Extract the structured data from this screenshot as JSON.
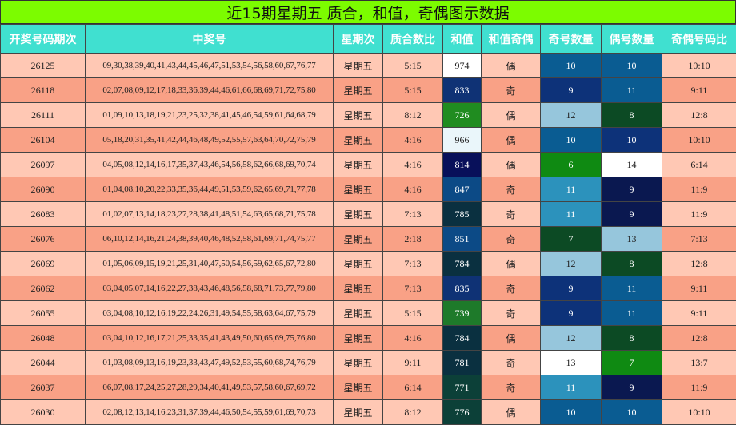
{
  "title": "近15期星期五 质合，和值，奇偶图示数据",
  "headers": [
    "开奖号码期次",
    "中奖号",
    "星期次",
    "质合数比",
    "和值",
    "和值奇偶",
    "奇号数量",
    "偶号数量",
    "奇偶号码比"
  ],
  "rows": [
    {
      "issue": "26125",
      "numbers": "09,30,38,39,40,41,43,44,45,46,47,51,53,54,56,58,60,67,76,77",
      "weekday": "星期五",
      "prime_ratio": "5:15",
      "sum": "974",
      "sum_parity": "偶",
      "odd_count": "10",
      "even_count": "10",
      "oe_ratio": "10:10",
      "sum_bg": "#ffffff",
      "sum_fg": "#222222",
      "odd_bg": "#0a5c92",
      "even_bg": "#0a5c92",
      "odd_fg": "#ffffff",
      "even_fg": "#ffffff"
    },
    {
      "issue": "26118",
      "numbers": "02,07,08,09,12,17,18,33,36,39,44,46,61,66,68,69,71,72,75,80",
      "weekday": "星期五",
      "prime_ratio": "5:15",
      "sum": "833",
      "sum_parity": "奇",
      "odd_count": "9",
      "even_count": "11",
      "oe_ratio": "9:11",
      "sum_bg": "#0f3275",
      "sum_fg": "#ffffff",
      "odd_bg": "#0d3279",
      "even_bg": "#0a5c92",
      "odd_fg": "#ffffff",
      "even_fg": "#ffffff"
    },
    {
      "issue": "26111",
      "numbers": "01,09,10,13,18,19,21,23,25,32,38,41,45,46,54,59,61,64,68,79",
      "weekday": "星期五",
      "prime_ratio": "8:12",
      "sum": "726",
      "sum_parity": "偶",
      "odd_count": "12",
      "even_count": "8",
      "oe_ratio": "12:8",
      "sum_bg": "#208c20",
      "sum_fg": "#ffffff",
      "odd_bg": "#96c6dc",
      "even_bg": "#0c4a24",
      "odd_fg": "#222222",
      "even_fg": "#ffffff"
    },
    {
      "issue": "26104",
      "numbers": "05,18,20,31,35,41,42,44,46,48,49,52,55,57,63,64,70,72,75,79",
      "weekday": "星期五",
      "prime_ratio": "4:16",
      "sum": "966",
      "sum_parity": "偶",
      "odd_count": "10",
      "even_count": "10",
      "oe_ratio": "10:10",
      "sum_bg": "#eaf6fa",
      "sum_fg": "#222222",
      "odd_bg": "#0a5c92",
      "even_bg": "#0d3279",
      "odd_fg": "#ffffff",
      "even_fg": "#ffffff"
    },
    {
      "issue": "26097",
      "numbers": "04,05,08,12,14,16,17,35,37,43,46,54,56,58,62,66,68,69,70,74",
      "weekday": "星期五",
      "prime_ratio": "4:16",
      "sum": "814",
      "sum_parity": "偶",
      "odd_count": "6",
      "even_count": "14",
      "oe_ratio": "6:14",
      "sum_bg": "#08105a",
      "sum_fg": "#ffffff",
      "odd_bg": "#0f8a12",
      "even_bg": "#ffffff",
      "odd_fg": "#ffffff",
      "even_fg": "#222222"
    },
    {
      "issue": "26090",
      "numbers": "01,04,08,10,20,22,33,35,36,44,49,51,53,59,62,65,69,71,77,78",
      "weekday": "星期五",
      "prime_ratio": "4:16",
      "sum": "847",
      "sum_parity": "奇",
      "odd_count": "11",
      "even_count": "9",
      "oe_ratio": "11:9",
      "sum_bg": "#0c4a86",
      "sum_fg": "#ffffff",
      "odd_bg": "#2c92bc",
      "even_bg": "#0a1850",
      "odd_fg": "#ffffff",
      "even_fg": "#ffffff"
    },
    {
      "issue": "26083",
      "numbers": "01,02,07,13,14,18,23,27,28,38,41,48,51,54,63,65,68,71,75,78",
      "weekday": "星期五",
      "prime_ratio": "7:13",
      "sum": "785",
      "sum_parity": "奇",
      "odd_count": "11",
      "even_count": "9",
      "oe_ratio": "11:9",
      "sum_bg": "#0a3040",
      "sum_fg": "#ffffff",
      "odd_bg": "#2c92bc",
      "even_bg": "#0a1850",
      "odd_fg": "#ffffff",
      "even_fg": "#ffffff"
    },
    {
      "issue": "26076",
      "numbers": "06,10,12,14,16,21,24,38,39,40,46,48,52,58,61,69,71,74,75,77",
      "weekday": "星期五",
      "prime_ratio": "2:18",
      "sum": "851",
      "sum_parity": "奇",
      "odd_count": "7",
      "even_count": "13",
      "oe_ratio": "7:13",
      "sum_bg": "#0c4a86",
      "sum_fg": "#ffffff",
      "odd_bg": "#0c4a24",
      "even_bg": "#96c6dc",
      "odd_fg": "#ffffff",
      "even_fg": "#222222"
    },
    {
      "issue": "26069",
      "numbers": "01,05,06,09,15,19,21,25,31,40,47,50,54,56,59,62,65,67,72,80",
      "weekday": "星期五",
      "prime_ratio": "7:13",
      "sum": "784",
      "sum_parity": "偶",
      "odd_count": "12",
      "even_count": "8",
      "oe_ratio": "12:8",
      "sum_bg": "#0a3040",
      "sum_fg": "#ffffff",
      "odd_bg": "#96c6dc",
      "even_bg": "#0c4a24",
      "odd_fg": "#222222",
      "even_fg": "#ffffff"
    },
    {
      "issue": "26062",
      "numbers": "03,04,05,07,14,16,22,27,38,43,46,48,56,58,68,71,73,77,79,80",
      "weekday": "星期五",
      "prime_ratio": "7:13",
      "sum": "835",
      "sum_parity": "奇",
      "odd_count": "9",
      "even_count": "11",
      "oe_ratio": "9:11",
      "sum_bg": "#0f3275",
      "sum_fg": "#ffffff",
      "odd_bg": "#0d3279",
      "even_bg": "#0a5c92",
      "odd_fg": "#ffffff",
      "even_fg": "#ffffff"
    },
    {
      "issue": "26055",
      "numbers": "03,04,08,10,12,16,19,22,24,26,31,49,54,55,58,63,64,67,75,79",
      "weekday": "星期五",
      "prime_ratio": "5:15",
      "sum": "739",
      "sum_parity": "奇",
      "odd_count": "9",
      "even_count": "11",
      "oe_ratio": "9:11",
      "sum_bg": "#1e7a2a",
      "sum_fg": "#ffffff",
      "odd_bg": "#0d3279",
      "even_bg": "#0a5c92",
      "odd_fg": "#ffffff",
      "even_fg": "#ffffff"
    },
    {
      "issue": "26048",
      "numbers": "03,04,10,12,16,17,21,25,33,35,41,43,49,50,60,65,69,75,76,80",
      "weekday": "星期五",
      "prime_ratio": "4:16",
      "sum": "784",
      "sum_parity": "偶",
      "odd_count": "12",
      "even_count": "8",
      "oe_ratio": "12:8",
      "sum_bg": "#0a3040",
      "sum_fg": "#ffffff",
      "odd_bg": "#96c6dc",
      "even_bg": "#0c4a24",
      "odd_fg": "#222222",
      "even_fg": "#ffffff"
    },
    {
      "issue": "26044",
      "numbers": "01,03,08,09,13,16,19,23,33,43,47,49,52,53,55,60,68,74,76,79",
      "weekday": "星期五",
      "prime_ratio": "9:11",
      "sum": "781",
      "sum_parity": "奇",
      "odd_count": "13",
      "even_count": "7",
      "oe_ratio": "13:7",
      "sum_bg": "#0a3040",
      "sum_fg": "#ffffff",
      "odd_bg": "#ffffff",
      "even_bg": "#0f8a12",
      "odd_fg": "#222222",
      "even_fg": "#ffffff"
    },
    {
      "issue": "26037",
      "numbers": "06,07,08,17,24,25,27,28,29,34,40,41,49,53,57,58,60,67,69,72",
      "weekday": "星期五",
      "prime_ratio": "6:14",
      "sum": "771",
      "sum_parity": "奇",
      "odd_count": "11",
      "even_count": "9",
      "oe_ratio": "11:9",
      "sum_bg": "#0c4038",
      "sum_fg": "#ffffff",
      "odd_bg": "#2c92bc",
      "even_bg": "#0a1850",
      "odd_fg": "#ffffff",
      "even_fg": "#ffffff"
    },
    {
      "issue": "26030",
      "numbers": "02,08,12,13,14,16,23,31,37,39,44,46,50,54,55,59,61,69,70,73",
      "weekday": "星期五",
      "prime_ratio": "8:12",
      "sum": "776",
      "sum_parity": "偶",
      "odd_count": "10",
      "even_count": "10",
      "oe_ratio": "10:10",
      "sum_bg": "#0c4038",
      "sum_fg": "#ffffff",
      "odd_bg": "#0a5c92",
      "even_bg": "#0a5c92",
      "odd_fg": "#ffffff",
      "even_fg": "#ffffff"
    }
  ]
}
